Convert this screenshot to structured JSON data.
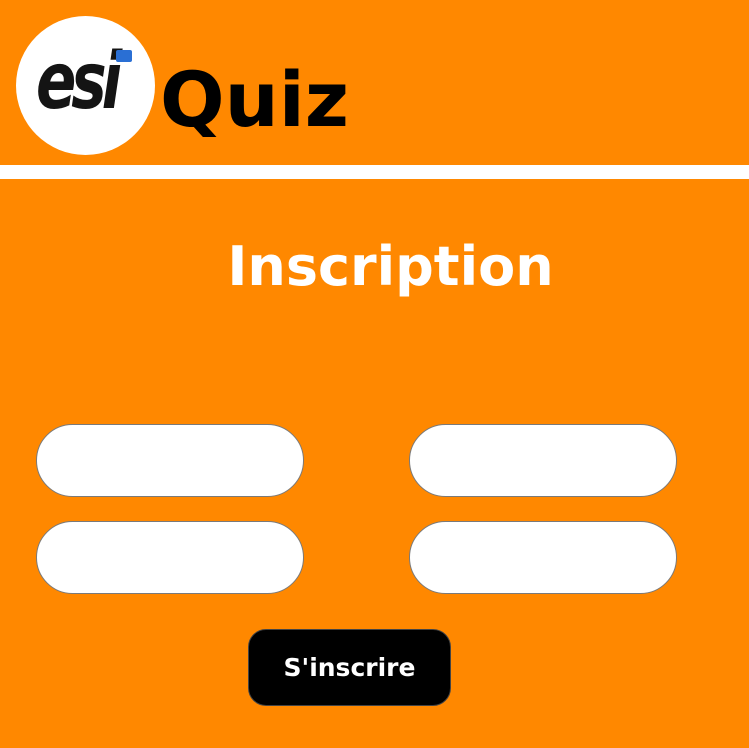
{
  "header": {
    "logo": {
      "text": "esi",
      "accent_color": "#2a6fd4"
    },
    "app_title": "Quiz"
  },
  "main": {
    "title": "Inscription",
    "form": {
      "fields": [
        {
          "placeholder": "",
          "value": ""
        },
        {
          "placeholder": "",
          "value": ""
        },
        {
          "placeholder": "",
          "value": ""
        },
        {
          "placeholder": "",
          "value": ""
        }
      ],
      "submit_label": "S'inscrire"
    }
  },
  "colors": {
    "background": "#ff8800",
    "divider": "#ffffff",
    "button_bg": "#000000",
    "button_text": "#ffffff"
  }
}
